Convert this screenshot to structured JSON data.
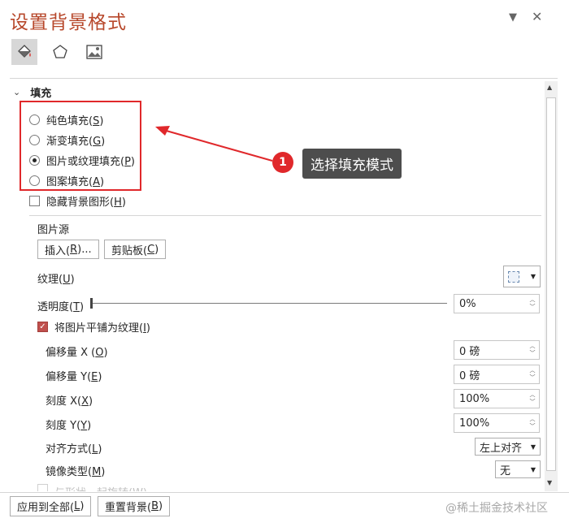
{
  "panel": {
    "title": "设置背景格式",
    "controls": {
      "dropdown_icon": "chevron-down-icon",
      "close_icon": "close-icon"
    }
  },
  "tabs": [
    {
      "name": "fill-tab",
      "icon": "paint-bucket-icon",
      "active": true
    },
    {
      "name": "effects-tab",
      "icon": "pentagon-icon",
      "active": false
    },
    {
      "name": "picture-tab",
      "icon": "image-icon",
      "active": false
    }
  ],
  "fill_section": {
    "header": "填充",
    "options": [
      {
        "label": "纯色填充(",
        "key": "S",
        "suffix": ")",
        "checked": false
      },
      {
        "label": "渐变填充(",
        "key": "G",
        "suffix": ")",
        "checked": false
      },
      {
        "label": "图片或纹理填充(",
        "key": "P",
        "suffix": ")",
        "checked": true
      },
      {
        "label": "图案填充(",
        "key": "A",
        "suffix": ")",
        "checked": false
      }
    ],
    "hide_background": {
      "label": "隐藏背景图形(",
      "key": "H",
      "suffix": ")",
      "checked": false
    }
  },
  "picture_source": {
    "label": "图片源",
    "insert_label": "插入(",
    "insert_key": "R",
    "insert_suffix": ")...",
    "clipboard_label": "剪贴板(",
    "clipboard_key": "C",
    "clipboard_suffix": ")"
  },
  "texture": {
    "label": "纹理(",
    "key": "U",
    "suffix": ")"
  },
  "transparency": {
    "label": "透明度(",
    "key": "T",
    "suffix": ")",
    "value": "0%",
    "level_percent": 0
  },
  "tile": {
    "label": "将图片平铺为纹理(",
    "key": "I",
    "suffix": ")",
    "checked": true
  },
  "fields": [
    {
      "label": "偏移量 X (",
      "key": "O",
      "suffix": ")",
      "value": "0 磅"
    },
    {
      "label": "偏移量 Y(",
      "key": "E",
      "suffix": ")",
      "value": "0 磅"
    },
    {
      "label": "刻度 X(",
      "key": "X",
      "suffix": ")",
      "value": "100%"
    },
    {
      "label": "刻度 Y(",
      "key": "Y",
      "suffix": ")",
      "value": "100%"
    }
  ],
  "alignment": {
    "label": "对齐方式(",
    "key": "L",
    "suffix": ")",
    "value": "左上对齐"
  },
  "mirror": {
    "label": "镜像类型(",
    "key": "M",
    "suffix": ")",
    "value": "无"
  },
  "rotate_with_shape": {
    "label": "与形状一起旋转(W)"
  },
  "footer": {
    "apply_all": "应用到全部(",
    "apply_all_key": "L",
    "apply_all_suffix": ")",
    "reset": "重置背景(",
    "reset_key": "B",
    "reset_suffix": ")"
  },
  "annotation": {
    "badge": "1",
    "text": "选择填充模式",
    "highlight_color": "#e0282b"
  },
  "watermark": "@稀土掘金技术社区"
}
